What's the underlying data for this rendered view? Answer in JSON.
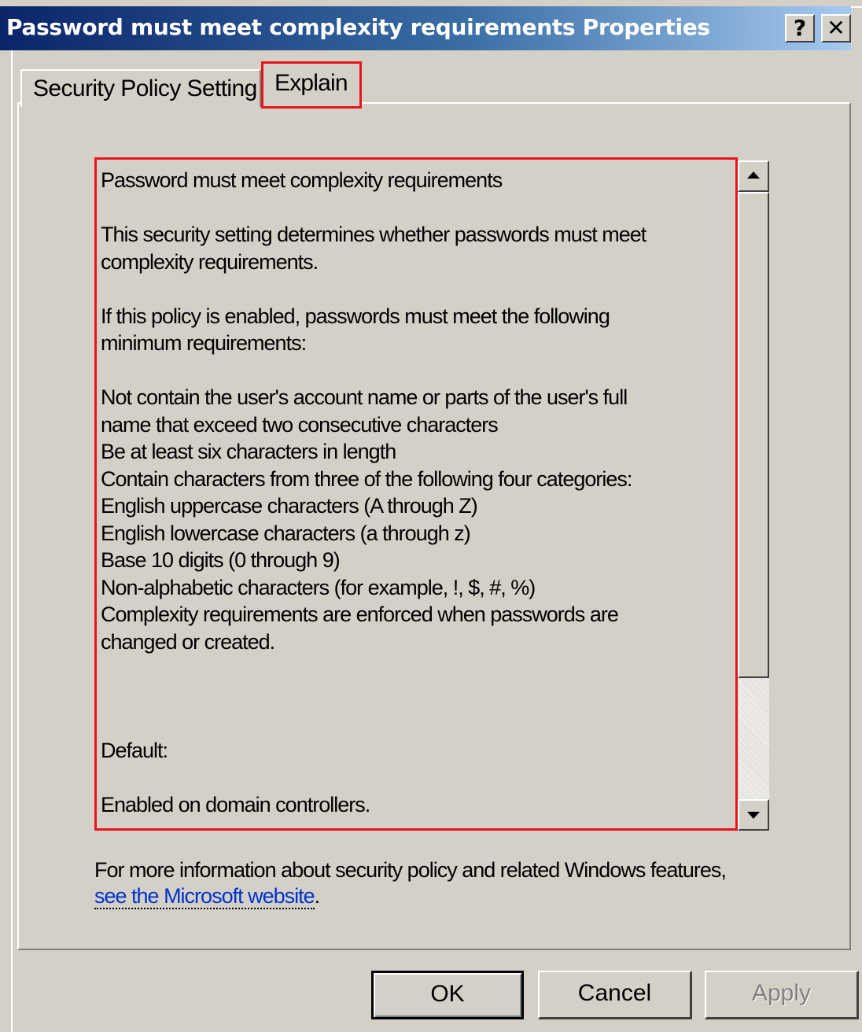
{
  "window": {
    "title": "Password must meet complexity requirements Properties",
    "help_button": "?",
    "close_button": "✕"
  },
  "tabs": [
    {
      "label": "Security Policy Setting",
      "selected": false
    },
    {
      "label": "Explain",
      "selected": true
    }
  ],
  "explain": {
    "lines": [
      "Password must meet complexity requirements",
      "",
      "This security setting determines whether passwords must meet",
      "complexity requirements.",
      "",
      "If this policy is enabled, passwords must meet the following",
      "minimum requirements:",
      "",
      "Not contain the user's account name or parts of the user's full",
      "name that exceed two consecutive characters",
      "Be at least six characters in length",
      "Contain characters from three of the following four categories:",
      "English uppercase characters (A through Z)",
      "English lowercase characters (a through z)",
      "Base 10 digits (0 through 9)",
      "Non-alphabetic characters (for example, !, $, #, %)",
      "Complexity requirements are enforced when passwords are",
      "changed or created.",
      "",
      "",
      "",
      "Default:",
      "",
      "Enabled on domain controllers."
    ]
  },
  "more_info": {
    "text_before": "For more information about security policy and related Windows features, ",
    "link_text": "see the Microsoft website",
    "text_after": "."
  },
  "buttons": {
    "ok": "OK",
    "cancel": "Cancel",
    "apply": "Apply"
  },
  "colors": {
    "dialog_bg": "#d4d0c8",
    "titlebar_start": "#0a246a",
    "titlebar_end": "#a6caf0",
    "highlight_frame": "#e8131b",
    "link": "#0033cc"
  }
}
